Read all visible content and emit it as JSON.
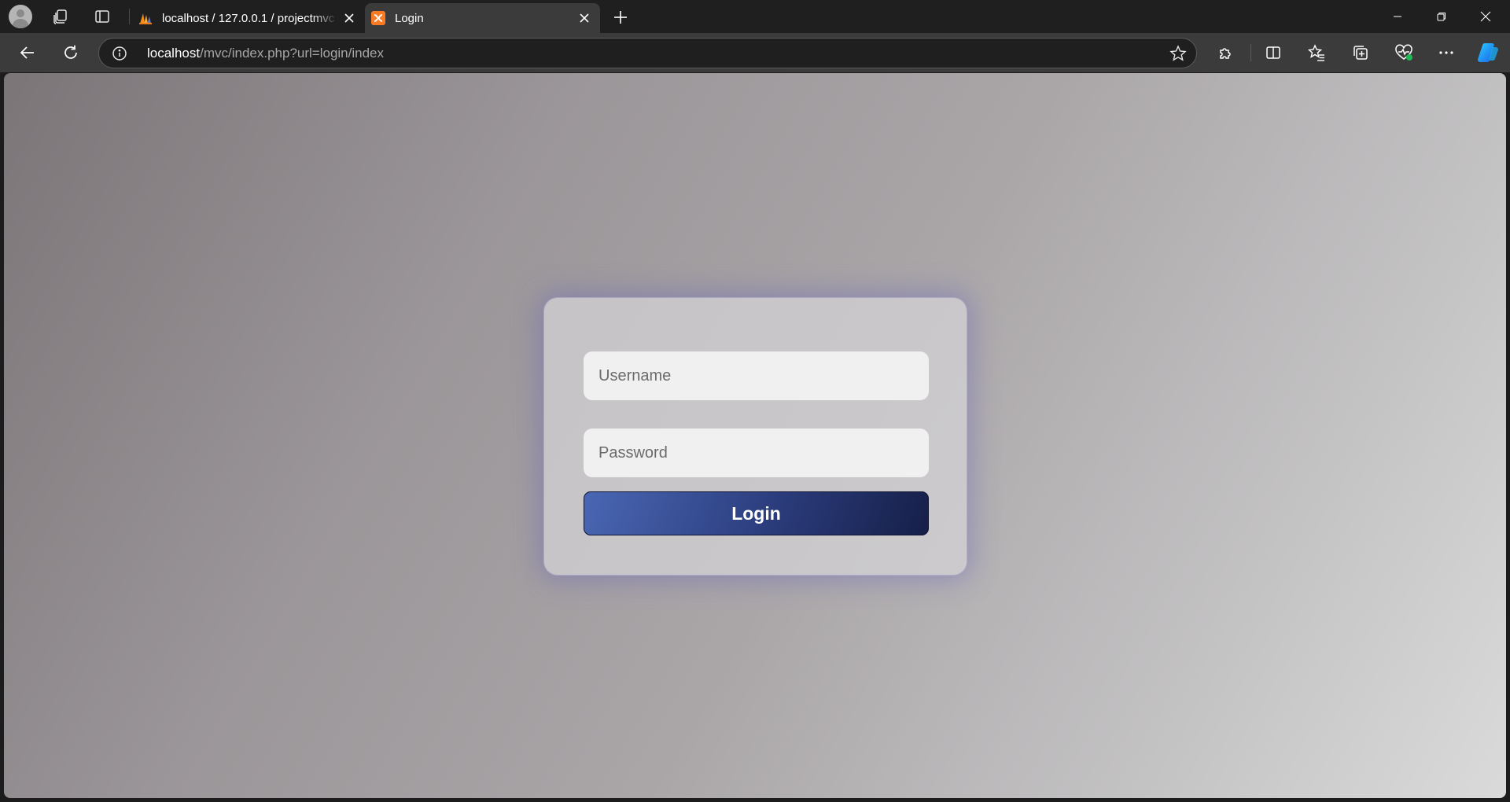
{
  "browser": {
    "tabs": [
      {
        "title": "localhost / 127.0.0.1 / projectmvc",
        "favicon": "phpmyadmin-icon",
        "active": false
      },
      {
        "title": "Login",
        "favicon": "xampp-icon",
        "active": true
      }
    ],
    "address_bar": {
      "host": "localhost",
      "path": "/mvc/index.php?url=login/index"
    },
    "colors": {
      "tabstrip": "#1f1f1f",
      "toolbar": "#3b3b3b",
      "copilot_blue": "#1aa3e8",
      "health_green": "#1db954"
    }
  },
  "login_form": {
    "username_placeholder": "Username",
    "password_placeholder": "Password",
    "submit_label": "Login",
    "colors": {
      "button_start": "#4a67b4",
      "button_end": "#161f48",
      "card_glow": "#5f5abe",
      "field_bg": "#f0f0f0"
    }
  }
}
